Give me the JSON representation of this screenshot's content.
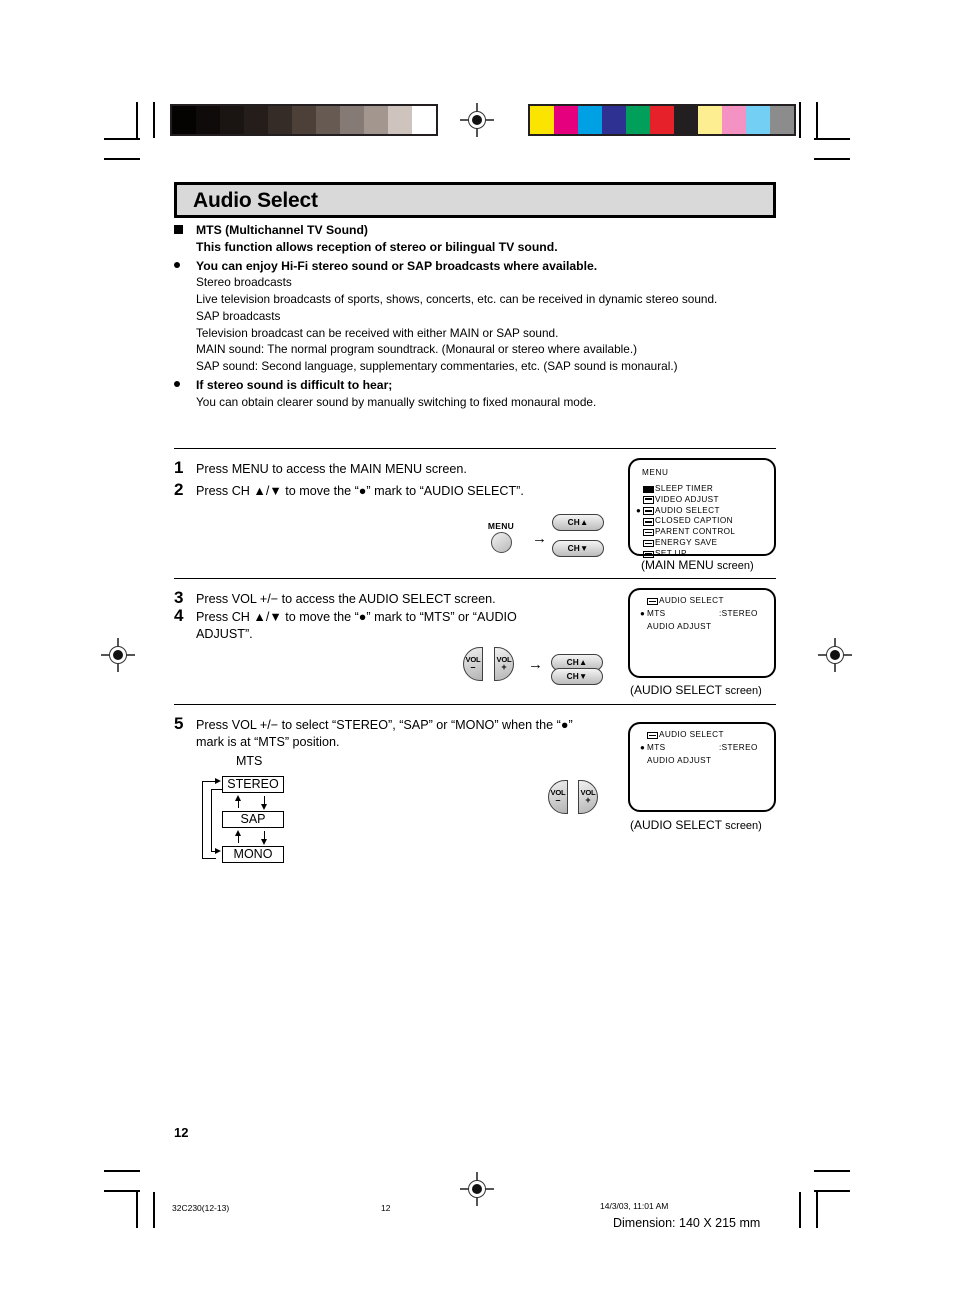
{
  "page": {
    "title": "Audio Select",
    "page_number": "12"
  },
  "intro": {
    "heading_line1": "MTS (Multichannel TV Sound)",
    "heading_line2": "This function allows reception of stereo or bilingual TV sound.",
    "bullet1": "You can enjoy Hi-Fi stereo sound or SAP broadcasts where available.",
    "bullet1_lines": [
      "Stereo broadcasts",
      "Live television broadcasts of sports, shows, concerts, etc. can be received in dynamic stereo sound.",
      "SAP broadcasts",
      "Television broadcast can be received with either MAIN or SAP sound.",
      "MAIN sound: The normal program soundtrack. (Monaural or stereo where available.)",
      "SAP sound: Second language, supplementary commentaries, etc. (SAP sound is monaural.)"
    ],
    "bullet2": "If stereo sound is difficult to hear;",
    "bullet2_line": "You can obtain clearer sound by manually switching to fixed monaural mode."
  },
  "steps": [
    {
      "num": "1",
      "text": "Press MENU to access the MAIN MENU screen."
    },
    {
      "num": "2",
      "text": "Press CH ▲/▼ to move the “●” mark to “AUDIO SELECT”."
    },
    {
      "num": "3",
      "text": "Press VOL +/− to access the AUDIO SELECT screen."
    },
    {
      "num": "4",
      "text": "Press CH ▲/▼ to move the “●” mark to “MTS” or “AUDIO ADJUST”."
    },
    {
      "num": "5",
      "text": "Press VOL +/− to select “STEREO”, “SAP” or “MONO” when the “●” mark is at “MTS” position."
    }
  ],
  "keys": {
    "menu_label": "MENU",
    "ch_up_label": "CH▲",
    "ch_down_label": "CH▼",
    "vol_label": "VOL",
    "vol_minus": "–",
    "vol_plus": "+",
    "arrow": "→"
  },
  "main_menu_screen": {
    "title": "MENU",
    "caption_main": "(MAIN MENU",
    "caption_suffix": "screen)",
    "items": [
      {
        "label": "SLEEP TIMER",
        "icon": "sleep-timer-icon",
        "icon_style": "f",
        "selected": false
      },
      {
        "label": "VIDEO ADJUST",
        "icon": "video-adjust-icon",
        "icon_style": "h",
        "selected": false
      },
      {
        "label": "AUDIO SELECT",
        "icon": "audio-select-icon",
        "icon_style": "d",
        "selected": true
      },
      {
        "label": "CLOSED CAPTION",
        "icon": "closed-caption-icon",
        "icon_style": "d",
        "selected": false
      },
      {
        "label": "PARENT CONTROL",
        "icon": "parent-control-icon",
        "icon_style": "d",
        "selected": false
      },
      {
        "label": "ENERGY SAVE",
        "icon": "energy-save-icon",
        "icon_style": "d",
        "selected": false
      },
      {
        "label": "SET UP",
        "icon": "set-up-icon",
        "icon_style": "h",
        "selected": false
      }
    ]
  },
  "audio_select_screen": {
    "title": "AUDIO SELECT",
    "caption_main": "(AUDIO SELECT",
    "caption_suffix": "screen)",
    "rows": [
      {
        "label": "MTS",
        "value": ":STEREO",
        "selected": true
      },
      {
        "label": "AUDIO ADJUST",
        "value": "",
        "selected": false
      }
    ]
  },
  "mts_cycle": {
    "label": "MTS",
    "options": [
      "STEREO",
      "SAP",
      "MONO"
    ]
  },
  "footer": {
    "doc_code": "32C230(12-13)",
    "page_num": "12",
    "timestamp": "14/3/03, 11:01 AM",
    "dimension": "Dimension: 140  X 215 mm"
  },
  "calibration": {
    "gray_ramp": [
      "#050202",
      "#100b0b",
      "#1a1412",
      "#241d1a",
      "#352c28",
      "#4c4039",
      "#665a53",
      "#857a74",
      "#a2968f",
      "#cfc3bd",
      "#ffffff"
    ],
    "colors": [
      "#fbe500",
      "#e5007e",
      "#00a0e4",
      "#2e3191",
      "#00a05a",
      "#e62129",
      "#231f20",
      "#fdee91",
      "#f492c3",
      "#74cff4",
      "#8c8c8c"
    ]
  }
}
